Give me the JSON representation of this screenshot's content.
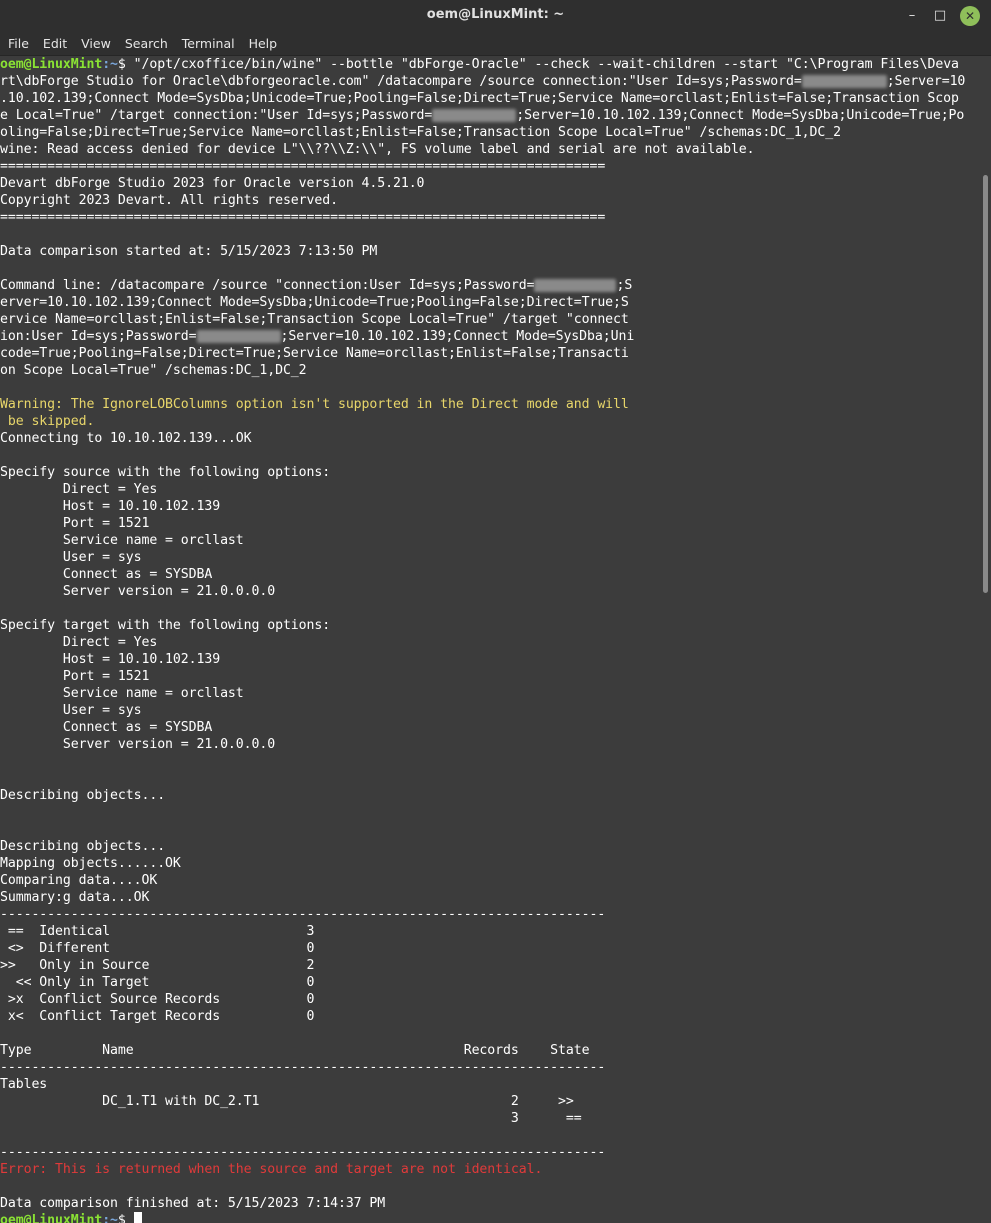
{
  "window": {
    "title": "oem@LinuxMint: ~",
    "minimize_icon": "minimize-icon",
    "maximize_icon": "maximize-icon",
    "close_icon": "close-icon"
  },
  "menu": [
    "File",
    "Edit",
    "View",
    "Search",
    "Terminal",
    "Help"
  ],
  "prompt": {
    "user": "oem@LinuxMint",
    "path": ":~",
    "symbol": "$ "
  },
  "command": {
    "l1": "\"/opt/cxoffice/bin/wine\" --bottle \"dbForge-Oracle\" --check --wait-children --start \"C:\\Program Files\\Deva",
    "l2a": "rt\\dbForge Studio for Oracle\\dbforgeoracle.com\" /datacompare /source connection:\"User Id=sys;Password=",
    "l2b": ";Server=10",
    "l3": ".10.102.139;Connect Mode=SysDba;Unicode=True;Pooling=False;Direct=True;Service Name=orcllast;Enlist=False;Transaction Scop",
    "l4a": "e Local=True\" /target connection:\"User Id=sys;Password=",
    "l4b": ";Server=10.10.102.139;Connect Mode=SysDba;Unicode=True;Po",
    "l5": "oling=False;Direct=True;Service Name=orcllast;Enlist=False;Transaction Scope Local=True\" /schemas:DC_1,DC_2"
  },
  "wine_warning": "wine: Read access denied for device L\"\\\\??\\\\Z:\\\\\", FS volume label and serial are not available.",
  "rule_eq": "=============================================================================",
  "rule_dash": "-----------------------------------------------------------------------------",
  "header": {
    "product": "Devart dbForge Studio 2023 for Oracle version 4.5.21.0",
    "copyright": "Copyright 2023 Devart. All rights reserved."
  },
  "started": "Data comparison started at: 5/15/2023 7:13:50 PM",
  "cmdline": {
    "l1a": "Command line: /datacompare /source \"connection:User Id=sys;Password=",
    "l1b": ";S",
    "l2": "erver=10.10.102.139;Connect Mode=SysDba;Unicode=True;Pooling=False;Direct=True;S",
    "l3": "ervice Name=orcllast;Enlist=False;Transaction Scope Local=True\" /target \"connect",
    "l4a": "ion:User Id=sys;Password=",
    "l4b": ";Server=10.10.102.139;Connect Mode=SysDba;Uni",
    "l5": "code=True;Pooling=False;Direct=True;Service Name=orcllast;Enlist=False;Transacti",
    "l6": "on Scope Local=True\" /schemas:DC_1,DC_2"
  },
  "ignore_warning": {
    "l1": "Warning: The IgnoreLOBColumns option isn't supported in the Direct mode and will",
    "l2": " be skipped."
  },
  "connecting": "Connecting to 10.10.102.139...OK",
  "source_opts": {
    "heading": "Specify source with the following options:",
    "lines": [
      "        Direct = Yes",
      "        Host = 10.10.102.139",
      "        Port = 1521",
      "        Service name = orcllast",
      "        User = sys",
      "        Connect as = SYSDBA",
      "        Server version = 21.0.0.0.0"
    ]
  },
  "target_opts": {
    "heading": "Specify target with the following options:",
    "lines": [
      "        Direct = Yes",
      "        Host = 10.10.102.139",
      "        Port = 1521",
      "        Service name = orcllast",
      "        User = sys",
      "        Connect as = SYSDBA",
      "        Server version = 21.0.0.0.0"
    ]
  },
  "describing": "Describing objects...",
  "progress": [
    "Describing objects...",
    "Mapping objects......OK",
    "Comparing data....OK",
    "Summary:g data...OK"
  ],
  "summary": [
    " ==  Identical                         3",
    " <>  Different                         0",
    ">>   Only in Source                    2",
    "  << Only in Target                    0",
    " >x  Conflict Source Records           0",
    " x<  Conflict Target Records           0"
  ],
  "table_header": "Type         Name                                          Records    State",
  "tables_label": "Tables",
  "table_rows": [
    "             DC_1.T1 with DC_2.T1                                2     >>",
    "                                                                 3      =="
  ],
  "error": "Error: This is returned when the source and target are not identical.",
  "finished": "Data comparison finished at: 5/15/2023 7:14:37 PM"
}
